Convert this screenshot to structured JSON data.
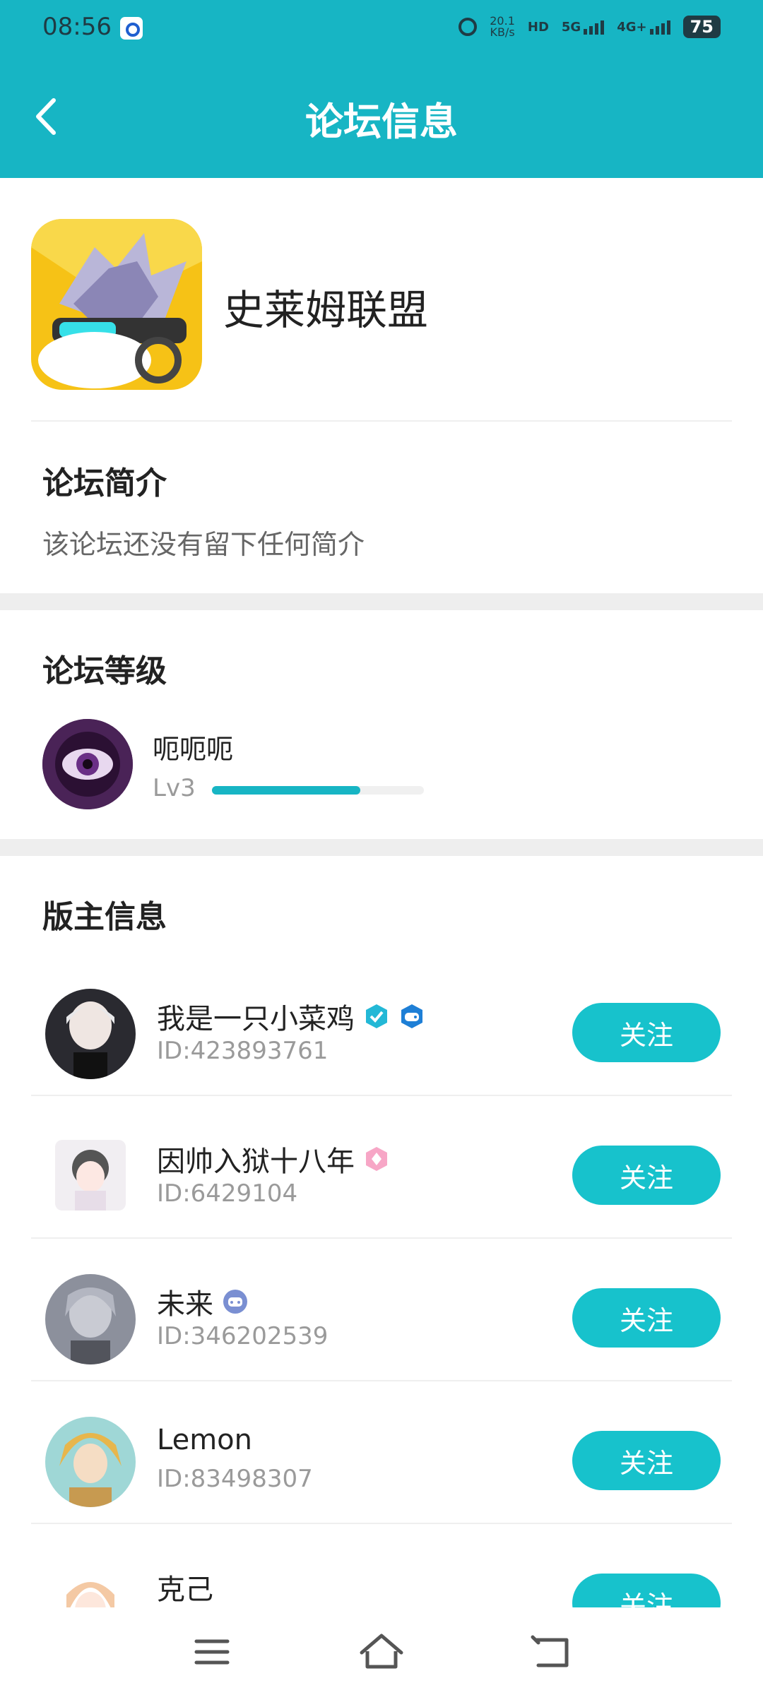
{
  "status": {
    "time": "08:56",
    "net_speed": "20.1",
    "net_unit": "KB/s",
    "hd": "HD",
    "sim1": "5G",
    "sim2": "4G+",
    "battery": "75"
  },
  "header": {
    "title": "论坛信息"
  },
  "forum": {
    "name": "史莱姆联盟"
  },
  "intro": {
    "title": "论坛简介",
    "text": "该论坛还没有留下任何简介"
  },
  "level": {
    "title": "论坛等级",
    "name": "呃呃呃",
    "lv": "Lv3",
    "progress": 0.7
  },
  "moderators": {
    "title": "版主信息",
    "items": [
      {
        "name": "我是一只小菜鸡",
        "id": "ID:423893761",
        "follow": "关注"
      },
      {
        "name": "因帅入狱十八年",
        "id": "ID:6429104",
        "follow": "关注"
      },
      {
        "name": "未来",
        "id": "ID:346202539",
        "follow": "关注"
      },
      {
        "name": "Lemon",
        "id": "ID:83498307",
        "follow": "关注"
      },
      {
        "name": "克己",
        "id": "",
        "follow": "关注"
      }
    ]
  },
  "colors": {
    "accent": "#17b5c4",
    "button": "#17c2cc"
  }
}
